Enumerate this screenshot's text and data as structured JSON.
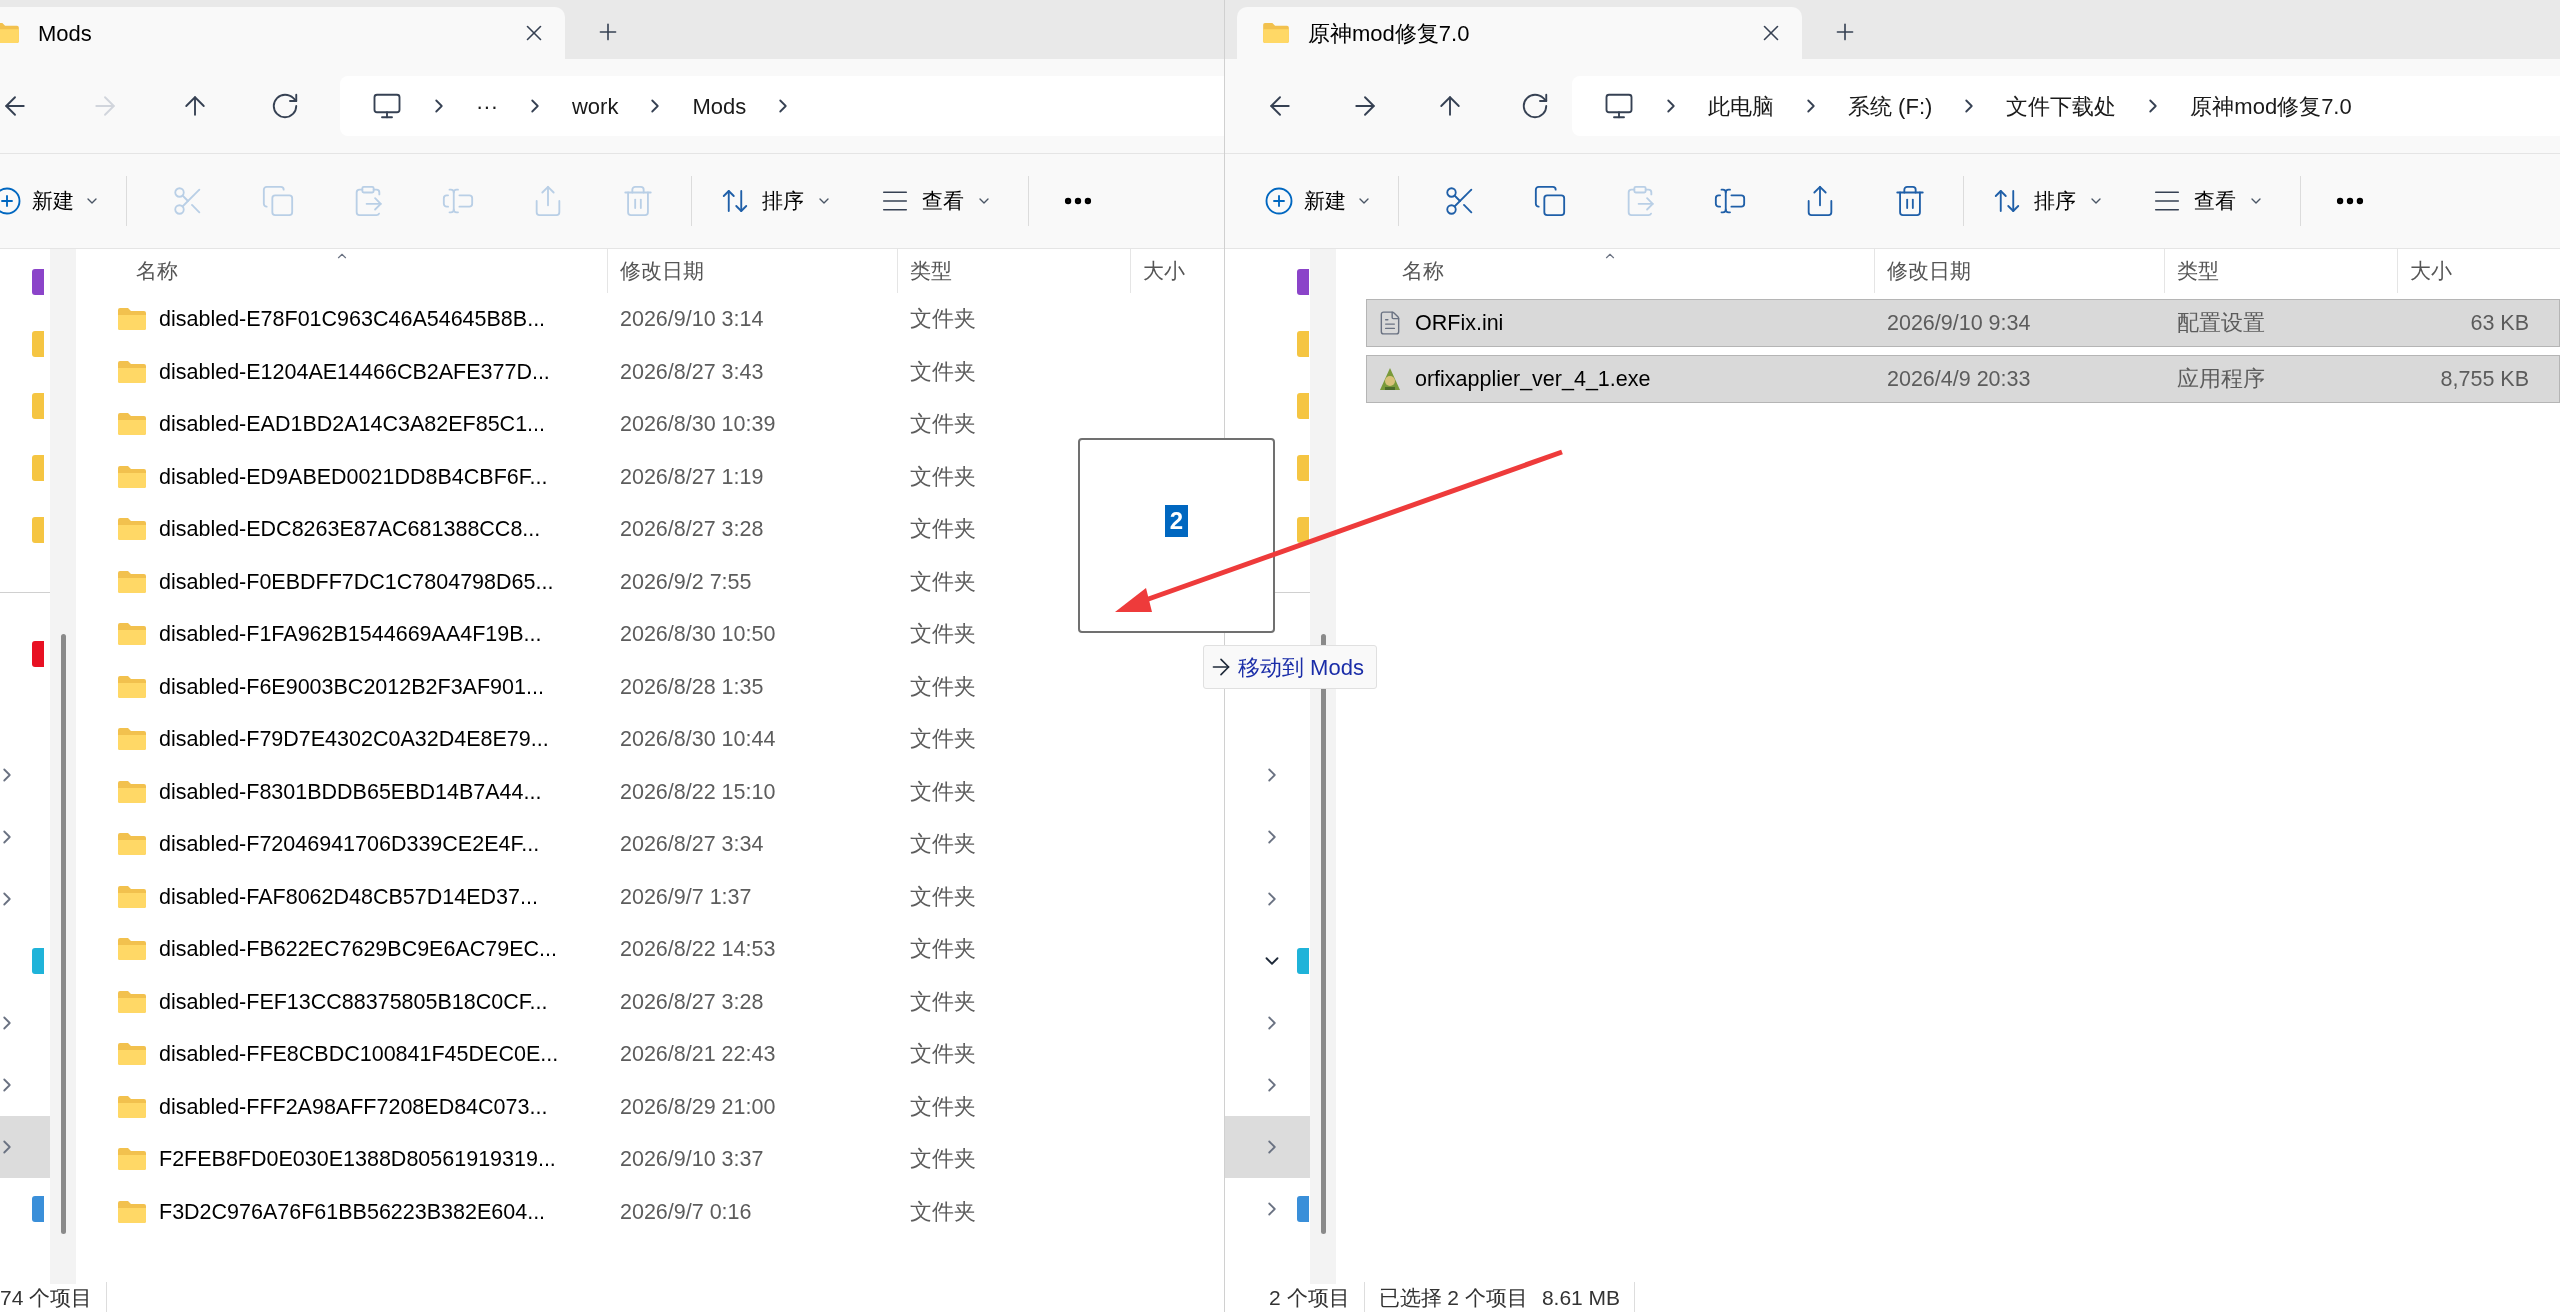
{
  "windows": [
    {
      "tab": {
        "title": "Mods",
        "selected": true
      },
      "nav_buttons": [
        {
          "kind": "back",
          "disabled": false
        },
        {
          "kind": "forward",
          "disabled": true
        },
        {
          "kind": "up",
          "disabled": false
        },
        {
          "kind": "refresh",
          "disabled": false
        }
      ],
      "breadcrumbs": [
        "···",
        "work",
        "Mods"
      ],
      "breadcrumb_trailing_chevron": true,
      "toolbar": {
        "new_label": "新建",
        "actions": [
          {
            "kind": "cut",
            "disabled": true
          },
          {
            "kind": "copy",
            "disabled": true
          },
          {
            "kind": "paste",
            "disabled": true
          },
          {
            "kind": "rename",
            "disabled": true
          },
          {
            "kind": "share",
            "disabled": true
          },
          {
            "kind": "delete",
            "disabled": true
          }
        ],
        "sort_label": "排序",
        "view_label": "查看"
      },
      "nav_pane": {
        "top": [
          {
            "color": "#8b44c9",
            "selected": false
          },
          {
            "color": "#f5c542",
            "selected": false
          },
          {
            "color": "#f5c542",
            "selected": false
          },
          {
            "color": "#f5c542",
            "selected": false
          },
          {
            "color": "#f5c542",
            "selected": false
          },
          {
            "kind": "divider"
          },
          {
            "color": "#e81123",
            "selected": false
          }
        ],
        "bottom": [
          {
            "expanded": false,
            "selected": false
          },
          {
            "expanded": false,
            "selected": false
          },
          {
            "expanded": false,
            "selected": false
          },
          {
            "color": "#1fb3d9",
            "selected": false
          },
          {
            "expanded": false,
            "selected": false
          },
          {
            "expanded": false,
            "selected": false
          },
          {
            "expanded": false,
            "selected": true
          },
          {
            "color": "#3a8fd9",
            "selected": false
          }
        ]
      },
      "columns": [
        "名称",
        "修改日期",
        "类型",
        "大小"
      ],
      "rows": [
        {
          "kind": "folder",
          "name": "disabled-E78F01C963C46A54645B8B...",
          "date": "2026/9/10 3:14",
          "type": "文件夹",
          "selected": false
        },
        {
          "kind": "folder",
          "name": "disabled-E1204AE14466CB2AFE377D...",
          "date": "2026/8/27 3:43",
          "type": "文件夹",
          "selected": false
        },
        {
          "kind": "folder",
          "name": "disabled-EAD1BD2A14C3A82EF85C1...",
          "date": "2026/8/30 10:39",
          "type": "文件夹",
          "selected": false
        },
        {
          "kind": "folder",
          "name": "disabled-ED9ABED0021DD8B4CBF6F...",
          "date": "2026/8/27 1:19",
          "type": "文件夹",
          "selected": false
        },
        {
          "kind": "folder",
          "name": "disabled-EDC8263E87AC681388CC8...",
          "date": "2026/8/27 3:28",
          "type": "文件夹",
          "selected": false
        },
        {
          "kind": "folder",
          "name": "disabled-F0EBDFF7DC1C7804798D65...",
          "date": "2026/9/2 7:55",
          "type": "文件夹",
          "selected": false
        },
        {
          "kind": "folder",
          "name": "disabled-F1FA962B1544669AA4F19B...",
          "date": "2026/8/30 10:50",
          "type": "文件夹",
          "selected": false
        },
        {
          "kind": "folder",
          "name": "disabled-F6E9003BC2012B2F3AF901...",
          "date": "2026/8/28 1:35",
          "type": "文件夹",
          "selected": false
        },
        {
          "kind": "folder",
          "name": "disabled-F79D7E4302C0A32D4E8E79...",
          "date": "2026/8/30 10:44",
          "type": "文件夹",
          "selected": false
        },
        {
          "kind": "folder",
          "name": "disabled-F8301BDDB65EBD14B7A44...",
          "date": "2026/8/22 15:10",
          "type": "文件夹",
          "selected": false
        },
        {
          "kind": "folder",
          "name": "disabled-F72046941706D339CE2E4F...",
          "date": "2026/8/27 3:34",
          "type": "文件夹",
          "selected": false
        },
        {
          "kind": "folder",
          "name": "disabled-FAF8062D48CB57D14ED37...",
          "date": "2026/9/7 1:37",
          "type": "文件夹",
          "selected": false
        },
        {
          "kind": "folder",
          "name": "disabled-FB622EC7629BC9E6AC79EC...",
          "date": "2026/8/22 14:53",
          "type": "文件夹",
          "selected": false
        },
        {
          "kind": "folder",
          "name": "disabled-FEF13CC88375805B18C0CF...",
          "date": "2026/8/27 3:28",
          "type": "文件夹",
          "selected": false
        },
        {
          "kind": "folder",
          "name": "disabled-FFE8CBDC100841F45DEC0E...",
          "date": "2026/8/21 22:43",
          "type": "文件夹",
          "selected": false
        },
        {
          "kind": "folder",
          "name": "disabled-FFF2A98AFF7208ED84C073...",
          "date": "2026/8/29 21:00",
          "type": "文件夹",
          "selected": false
        },
        {
          "kind": "folder",
          "name": "F2FEB8FD0E030E1388D80561919319...",
          "date": "2026/9/10 3:37",
          "type": "文件夹",
          "selected": false
        },
        {
          "kind": "folder",
          "name": "F3D2C976A76F61BB56223B382E604...",
          "date": "2026/9/7 0:16",
          "type": "文件夹",
          "selected": false
        }
      ],
      "status": [
        "74 个项目"
      ]
    },
    {
      "tab": {
        "title": "原神mod修复7.0",
        "selected": true
      },
      "nav_buttons": [
        {
          "kind": "back",
          "disabled": false
        },
        {
          "kind": "forward",
          "disabled": false
        },
        {
          "kind": "up",
          "disabled": false
        },
        {
          "kind": "refresh",
          "disabled": false
        }
      ],
      "breadcrumbs": [
        "此电脑",
        "系统 (F:)",
        "文件下载处",
        "原神mod修复7.0"
      ],
      "breadcrumb_trailing_chevron": false,
      "toolbar": {
        "new_label": "新建",
        "actions": [
          {
            "kind": "cut",
            "disabled": false
          },
          {
            "kind": "copy",
            "disabled": false
          },
          {
            "kind": "paste",
            "disabled": true
          },
          {
            "kind": "rename",
            "disabled": false
          },
          {
            "kind": "share",
            "disabled": false
          },
          {
            "kind": "delete",
            "disabled": false
          }
        ],
        "sort_label": "排序",
        "view_label": "查看"
      },
      "nav_pane": {
        "top": [
          {
            "color": "#8b44c9",
            "selected": false
          },
          {
            "color": "#f5c542",
            "selected": false
          },
          {
            "color": "#f5c542",
            "selected": false
          },
          {
            "color": "#f5c542",
            "selected": false
          },
          {
            "color": "#f5c542",
            "selected": false
          },
          {
            "kind": "divider"
          }
        ],
        "bottom": [
          {
            "expanded": false,
            "selected": false
          },
          {
            "expanded": false,
            "selected": false
          },
          {
            "expanded": false,
            "selected": false
          },
          {
            "expanded": true,
            "color": "#1fb3d9",
            "selected": false
          },
          {
            "expanded": false,
            "selected": false
          },
          {
            "expanded": false,
            "selected": false
          },
          {
            "expanded": false,
            "selected": true
          },
          {
            "expanded": false,
            "color": "#3a8fd9",
            "selected": false
          }
        ]
      },
      "columns": [
        "名称",
        "修改日期",
        "类型",
        "大小"
      ],
      "rows": [
        {
          "kind": "ini",
          "name": "ORFix.ini",
          "date": "2026/9/10 9:34",
          "type": "配置设置",
          "size": "63 KB",
          "selected": true
        },
        {
          "kind": "exe",
          "name": "orfixapplier_ver_4_1.exe",
          "date": "2026/4/9 20:33",
          "type": "应用程序",
          "size": "8,755 KB",
          "selected": true
        }
      ],
      "status": [
        "2 个项目",
        "已选择 2 个项目",
        "8.61 MB"
      ]
    }
  ],
  "drag": {
    "count": "2",
    "tooltip": "移动到 Mods"
  }
}
